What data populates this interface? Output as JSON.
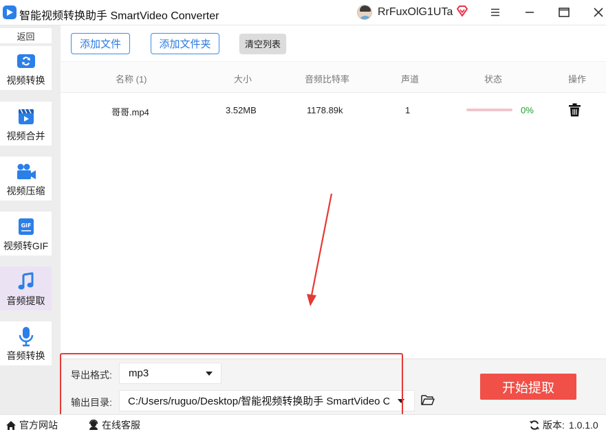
{
  "window": {
    "title": "智能视频转换助手 SmartVideo Converter",
    "user_name": "RrFuxOlG1UTa"
  },
  "sidebar": {
    "back_label": "返回",
    "items": [
      {
        "label": "视频转换",
        "icon": "video-convert-icon"
      },
      {
        "label": "视频合并",
        "icon": "video-merge-icon"
      },
      {
        "label": "视频压缩",
        "icon": "video-compress-icon"
      },
      {
        "label": "视频转GIF",
        "icon": "gif-icon"
      },
      {
        "label": "音频提取",
        "icon": "music-note-icon",
        "active": true
      },
      {
        "label": "音频转换",
        "icon": "microphone-icon"
      }
    ]
  },
  "toolbar": {
    "add_file": "添加文件",
    "add_folder": "添加文件夹",
    "clear_list": "清空列表"
  },
  "table": {
    "columns": [
      "名称 (1)",
      "大小",
      "音频比特率",
      "声道",
      "状态",
      "操作"
    ],
    "rows": [
      {
        "name": "哥哥.mp4",
        "size": "3.52MB",
        "bitrate": "1178.89k",
        "channels": "1",
        "progress_percent": 0,
        "status": "0%"
      }
    ]
  },
  "output": {
    "format_label": "导出格式:",
    "format_value": "mp3",
    "dir_label": "输出目录:",
    "dir_value": "C:/Users/ruguo/Desktop/智能视频转换助手 SmartVideo Converter"
  },
  "actions": {
    "start": "开始提取"
  },
  "statusbar": {
    "website": "官方网站",
    "support": "在线客服",
    "version_label": "版本:",
    "version": "1.0.1.0"
  },
  "colors": {
    "accent_blue": "#2a7ae2",
    "start_red": "#f05048",
    "annotation_red": "#e53935",
    "progress_track": "#f1c5ce",
    "progress_text": "#1aa02a",
    "active_nav": "#ebe3f4",
    "icon_blue": "#2b7fe8"
  }
}
